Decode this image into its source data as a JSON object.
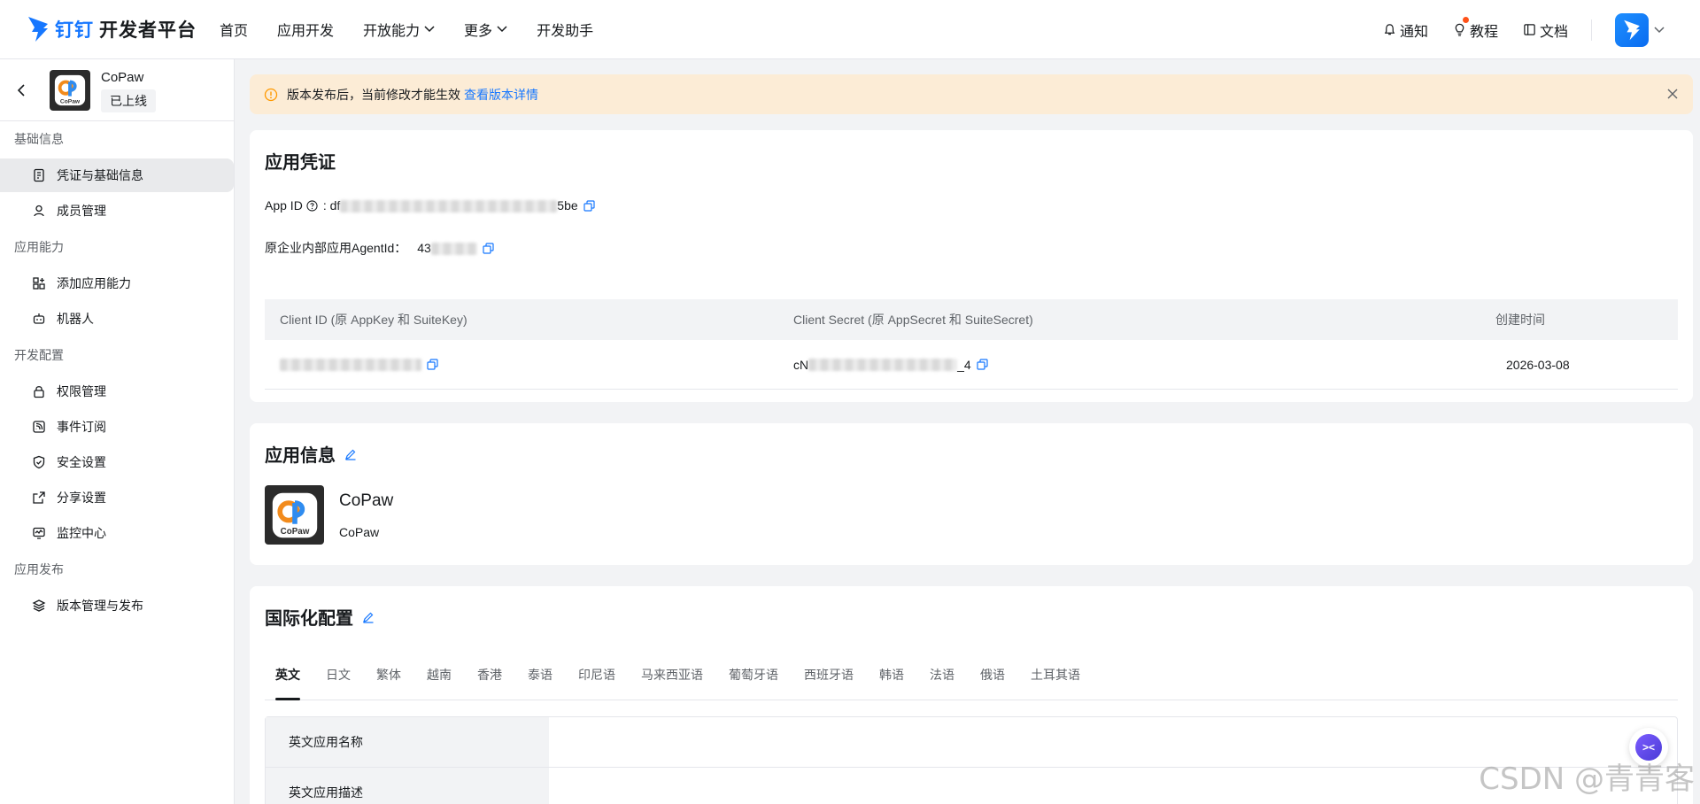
{
  "brand": {
    "mark": "钉钉",
    "name": "开发者平台"
  },
  "nav": {
    "items": [
      {
        "label": "首页",
        "dropdown": false
      },
      {
        "label": "应用开发",
        "dropdown": false
      },
      {
        "label": "开放能力",
        "dropdown": true
      },
      {
        "label": "更多",
        "dropdown": true
      },
      {
        "label": "开发助手",
        "dropdown": false
      }
    ]
  },
  "top_right": {
    "notify": "通知",
    "tutorial": "教程",
    "docs": "文档"
  },
  "sidebar": {
    "app_name": "CoPaw",
    "app_status": "已上线",
    "groups": [
      {
        "title": "基础信息",
        "items": [
          "凭证与基础信息",
          "成员管理"
        ]
      },
      {
        "title": "应用能力",
        "items": [
          "添加应用能力",
          "机器人"
        ]
      },
      {
        "title": "开发配置",
        "items": [
          "权限管理",
          "事件订阅",
          "安全设置",
          "分享设置",
          "监控中心"
        ]
      },
      {
        "title": "应用发布",
        "items": [
          "版本管理与发布"
        ]
      }
    ]
  },
  "notice": {
    "text": "版本发布后，当前修改才能生效",
    "link": "查看版本详情"
  },
  "credentials": {
    "title": "应用凭证",
    "app_id_label": "App ID",
    "app_id_prefix": "df",
    "app_id_suffix": "5be",
    "agent_label": "原企业内部应用AgentId：",
    "agent_prefix": "43",
    "table": {
      "headers": [
        "Client ID (原 AppKey 和 SuiteKey)",
        "Client Secret (原 AppSecret 和 SuiteSecret)",
        "创建时间"
      ],
      "secret_prefix": "cN",
      "secret_suffix": "_4",
      "created": "2026-03-08"
    }
  },
  "app_info": {
    "title": "应用信息",
    "name": "CoPaw",
    "desc": "CoPaw"
  },
  "intl": {
    "title": "国际化配置",
    "tabs": [
      "英文",
      "日文",
      "繁体",
      "越南",
      "香港",
      "泰语",
      "印尼语",
      "马来西亚语",
      "葡萄牙语",
      "西班牙语",
      "韩语",
      "法语",
      "俄语",
      "土耳其语"
    ],
    "rows": [
      "英文应用名称",
      "英文应用描述"
    ]
  },
  "watermark": "CSDN @青青客",
  "colors": {
    "accent": "#1677ff",
    "notice_bg": "#fcecd6",
    "warn": "#ff9900"
  }
}
